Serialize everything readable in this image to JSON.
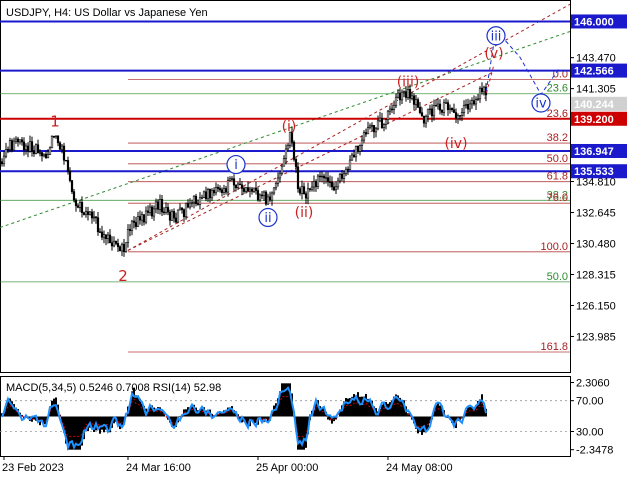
{
  "header": {
    "title": "USDJPY, H4:  US Dollar vs Japanese Yen",
    "indicator": "MACD(5,34,5) 0.5246 0.7008 RSI(14) 52.98"
  },
  "colors": {
    "candle": "#000000",
    "blue_level": "#1a1acc",
    "red_level": "#cc0000",
    "wave_red": "#cc2020",
    "wave_blue": "#1a33cc",
    "fib_green": "#2e8b2e",
    "fib_red": "#aa2222",
    "macd_hist": "#000000",
    "rsi": "#1e90ff",
    "signal": "#cc0000",
    "price_box": "#d0d0d0"
  },
  "chart_data": {
    "type": "candlestick",
    "symbol": "USDJPY",
    "timeframe": "H4",
    "ylim": [
      121.5,
      147.5
    ],
    "y_ticks": [
      "143.470",
      "141.305",
      "134.810",
      "132.645",
      "130.480",
      "128.315",
      "126.150",
      "123.985"
    ],
    "x_ticks": [
      "23 Feb 2023",
      "24 Mar 16:00",
      "25 Apr 00:00",
      "24 May 08:00"
    ],
    "price_path": [
      [
        0,
        136.2
      ],
      [
        8,
        137.2
      ],
      [
        20,
        137.5
      ],
      [
        35,
        137.0
      ],
      [
        45,
        136.5
      ],
      [
        55,
        138.2
      ],
      [
        65,
        136.5
      ],
      [
        75,
        133.5
      ],
      [
        85,
        132.8
      ],
      [
        95,
        132.0
      ],
      [
        105,
        131.0
      ],
      [
        115,
        130.6
      ],
      [
        122,
        130.0
      ],
      [
        132,
        131.8
      ],
      [
        145,
        132.4
      ],
      [
        160,
        133.2
      ],
      [
        175,
        132.2
      ],
      [
        190,
        133.2
      ],
      [
        205,
        133.8
      ],
      [
        218,
        134.0
      ],
      [
        232,
        134.8
      ],
      [
        245,
        134.2
      ],
      [
        258,
        133.8
      ],
      [
        270,
        133.6
      ],
      [
        280,
        135.5
      ],
      [
        290,
        138.1
      ],
      [
        298,
        134.5
      ],
      [
        305,
        133.8
      ],
      [
        315,
        134.8
      ],
      [
        325,
        135.0
      ],
      [
        332,
        134.2
      ],
      [
        345,
        135.5
      ],
      [
        355,
        136.8
      ],
      [
        365,
        138.1
      ],
      [
        375,
        138.5
      ],
      [
        385,
        139.2
      ],
      [
        395,
        140.5
      ],
      [
        405,
        141.2
      ],
      [
        415,
        140.3
      ],
      [
        425,
        139.2
      ],
      [
        435,
        140.0
      ],
      [
        445,
        140.1
      ],
      [
        455,
        139.4
      ],
      [
        465,
        139.8
      ],
      [
        475,
        140.3
      ],
      [
        482,
        141.5
      ],
      [
        486,
        140.6
      ]
    ],
    "levels": [
      {
        "label": "146.000",
        "price": 146.0,
        "color": "blue"
      },
      {
        "label": "142.566",
        "price": 142.566,
        "color": "blue"
      },
      {
        "label": "140.244",
        "price": 140.244,
        "color": "grey"
      },
      {
        "label": "139.200",
        "price": 139.2,
        "color": "red"
      },
      {
        "label": "136.947",
        "price": 136.947,
        "color": "blue"
      },
      {
        "label": "135.533",
        "price": 135.533,
        "color": "blue"
      }
    ],
    "fib_levels": [
      {
        "label": "0.0",
        "price": 141.95,
        "color": "red"
      },
      {
        "label": "23.6",
        "price": 140.95,
        "color": "green"
      },
      {
        "label": "23.6",
        "price": 139.2,
        "color": "red"
      },
      {
        "label": "38.2",
        "price": 137.5,
        "color": "red"
      },
      {
        "label": "50.0",
        "price": 136.05,
        "color": "red"
      },
      {
        "label": "61.8",
        "price": 134.8,
        "color": "red"
      },
      {
        "label": "38.2",
        "price": 133.5,
        "color": "green"
      },
      {
        "label": "76.0",
        "price": 133.3,
        "color": "red"
      },
      {
        "label": "100.0",
        "price": 129.9,
        "color": "red"
      },
      {
        "label": "50.0",
        "price": 127.8,
        "color": "green"
      },
      {
        "label": "161.8",
        "price": 122.9,
        "color": "red"
      }
    ],
    "wave_labels": [
      {
        "text": "1",
        "x": 55,
        "price": 139.0,
        "style": "red-plain"
      },
      {
        "text": "2",
        "x": 123,
        "price": 128.2,
        "style": "red-plain"
      },
      {
        "text": "i",
        "x": 236,
        "price": 136.0,
        "style": "blue-circle"
      },
      {
        "text": "ii",
        "x": 268,
        "price": 132.3,
        "style": "blue-circle"
      },
      {
        "text": "iii",
        "x": 496,
        "price": 145.0,
        "style": "blue-circle"
      },
      {
        "text": "iv",
        "x": 541,
        "price": 140.3,
        "style": "blue-circle"
      },
      {
        "text": "(i)",
        "x": 289,
        "price": 138.7,
        "style": "red-paren"
      },
      {
        "text": "(ii)",
        "x": 304,
        "price": 132.7,
        "style": "red-paren"
      },
      {
        "text": "(iii)",
        "x": 408,
        "price": 141.8,
        "style": "red-paren"
      },
      {
        "text": "(iv)",
        "x": 456,
        "price": 137.5,
        "style": "red-paren"
      },
      {
        "text": "(v)",
        "x": 494,
        "price": 143.8,
        "style": "red-paren"
      }
    ],
    "indicator": {
      "ticks": [
        "2.3060",
        "70.00",
        "30.00",
        "-2.3478"
      ]
    }
  }
}
